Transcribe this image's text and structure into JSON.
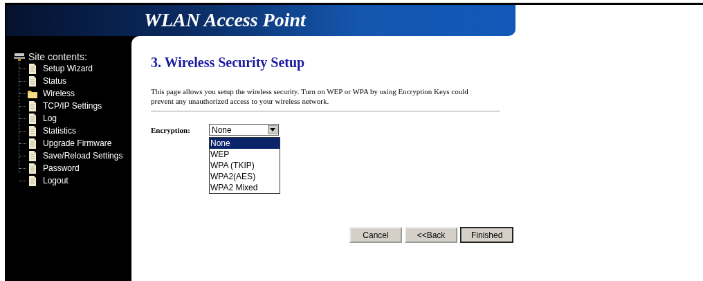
{
  "header": {
    "title": "WLAN Access Point"
  },
  "sidebar": {
    "heading": "Site contents:",
    "items": [
      {
        "label": "Setup Wizard",
        "kind": "page"
      },
      {
        "label": "Status",
        "kind": "page"
      },
      {
        "label": "Wireless",
        "kind": "folder"
      },
      {
        "label": "TCP/IP Settings",
        "kind": "page"
      },
      {
        "label": "Log",
        "kind": "page"
      },
      {
        "label": "Statistics",
        "kind": "page"
      },
      {
        "label": "Upgrade Firmware",
        "kind": "page"
      },
      {
        "label": "Save/Reload Settings",
        "kind": "page"
      },
      {
        "label": "Password",
        "kind": "page"
      },
      {
        "label": "Logout",
        "kind": "page"
      }
    ]
  },
  "content": {
    "title": "3. Wireless Security Setup",
    "description": "This page allows you setup the wireless security. Turn on WEP or WPA by using Encryption Keys could prevent any unauthorized access to your wireless network.",
    "encryption": {
      "label": "Encryption:",
      "value": "None",
      "expanded": true,
      "options": [
        {
          "label": "None",
          "selected": true
        },
        {
          "label": "WEP",
          "selected": false
        },
        {
          "label": "WPA (TKIP)",
          "selected": false
        },
        {
          "label": "WPA2(AES)",
          "selected": false
        },
        {
          "label": "WPA2 Mixed",
          "selected": false
        }
      ]
    },
    "buttons": [
      {
        "label": "Cancel",
        "default": false
      },
      {
        "label": "<<Back",
        "default": false
      },
      {
        "label": "Finished",
        "default": true
      }
    ]
  }
}
